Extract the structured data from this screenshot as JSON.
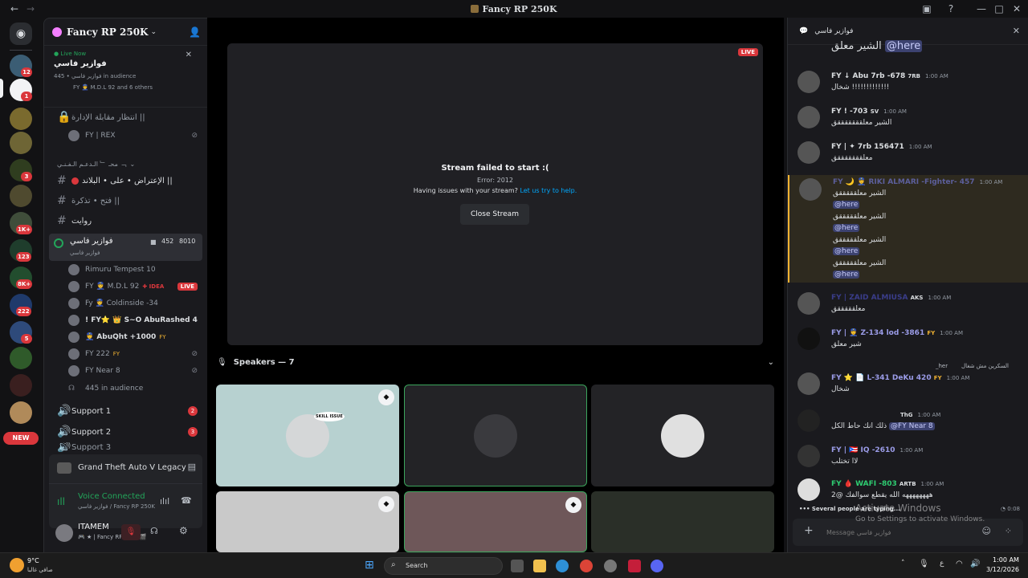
{
  "window": {
    "title": "Fancy RP 250K"
  },
  "rail": {
    "badges": [
      "12",
      "1",
      "3",
      "1K+",
      "123",
      "8K+",
      "222",
      "5"
    ],
    "new_label": "NEW"
  },
  "server": {
    "name": "Fancy RP 250K"
  },
  "live_card": {
    "live_label": "Live Now",
    "title": "فوازير فاسي",
    "audience": "فوازير فاسي • 445 in audience",
    "participants": "FY 👮 M.D.L 92 and 6 others"
  },
  "channels": {
    "c1": "انتظار مقابلة الإدارة ||",
    "c1_user": "FY | REX",
    "cat1": "محـ ﹂ الـدعـم الـفـنـي ﹁",
    "c2": "الإعتراض • على • البلاند ||",
    "c3": "فتح • تذكرة ||",
    "c4": "روايت",
    "stage_name": "فوازير فاسي",
    "stage_sub": "فوازير فاسي",
    "stage_count": "452",
    "stage_num": "8010",
    "users": [
      "Rimuru Tempest 10",
      "FY 👮 M.D.L 92",
      "Fy 👮 Coldinside -34",
      "! FY⭐ 👑 S~O AbuRashed 4",
      "👮 AbuQht +1000",
      "FY 222",
      "FY Near 8"
    ],
    "idea": "IDEA",
    "live": "LIVE",
    "fy_tag": "FY",
    "audience": "445 in audience",
    "support1": "Support 1",
    "support2": "Support 2",
    "support3": "Support 3",
    "sup_badge1": "2",
    "sup_badge2": "3"
  },
  "activity": {
    "game": "Grand Theft Auto V Legacy",
    "voice": "Voice Connected",
    "voice_sub": "فوازير فاسي / Fancy RP 250K"
  },
  "me": {
    "name": "ITAMEM",
    "status": "🎮 ★ | Fancy RP +2 • 🎬"
  },
  "stream": {
    "live": "LIVE",
    "error_title": "Stream failed to start :(",
    "error_code": "Error: 2012",
    "help_text": "Having issues with your stream?",
    "help_link": "Let us try to help.",
    "close": "Close Stream"
  },
  "speakers": {
    "label": "Speakers — 7",
    "skill": "SKILL ISSUE"
  },
  "chat": {
    "header": "فوازير فاسي",
    "top_text": "الشير معلق",
    "top_mention": "@here",
    "messages": [
      {
        "name": "FY ↓ Abu 7rb -678",
        "tag": "7RB",
        "time": "1:00 AM",
        "text": "شخال !!!!!!!!!!!!!"
      },
      {
        "name": "FY ! -703",
        "tag": "SV",
        "time": "1:00 AM",
        "text": "الشير معلقققققققق"
      },
      {
        "name": "FY | ✦ 7rb 156471",
        "tag": "",
        "time": "1:00 AM",
        "text": "معلقققققققق"
      },
      {
        "name": "FY 🌙 👮 RIKI ALMARI -Fighter- 457",
        "tag": "",
        "time": "1:00 AM",
        "text": "الشير معلقققققق"
      },
      {
        "name": "FY | ZAID ALMIUSA",
        "tag": "AKS",
        "time": "1:00 AM",
        "text": "معلقققققق"
      },
      {
        "name": "FY | 👮 Z-134 lod -3861",
        "tag": "FY",
        "time": "1:00 AM",
        "text": "شير معلق"
      },
      {
        "name": "FY ⭐ 📄 L-341 DeKu 420",
        "tag": "FY",
        "time": "1:00 AM",
        "text": "شخال"
      },
      {
        "name": "",
        "tag": "ThG",
        "time": "1:00 AM",
        "text": "ذلك انك حاط الكل"
      },
      {
        "name": "FY | 🇵🇷 IQ -2610",
        "tag": "",
        "time": "1:00 AM",
        "text": "لاا تختلب"
      },
      {
        "name": "FY 🩸 WAFI -803",
        "tag": "ARTB",
        "time": "1:00 AM",
        "text": "ههههههههه الله يقطع سوالفك @2"
      }
    ],
    "mention": "@here",
    "near_mention": "@FY Near 8",
    "reply_text": "السكرين مش شغال",
    "reply_user": "_her",
    "typing": "Several people are typing...",
    "time_left": "0:08",
    "placeholder": "Message فوازير فاسي",
    "activate1": "Activate Windows",
    "activate2": "Go to Settings to activate Windows."
  },
  "taskbar": {
    "temp": "9°C",
    "weather": "صافي غالبا",
    "search": "Search",
    "lang": "ع",
    "time": "1:00 AM",
    "date": "3/12/2026"
  }
}
